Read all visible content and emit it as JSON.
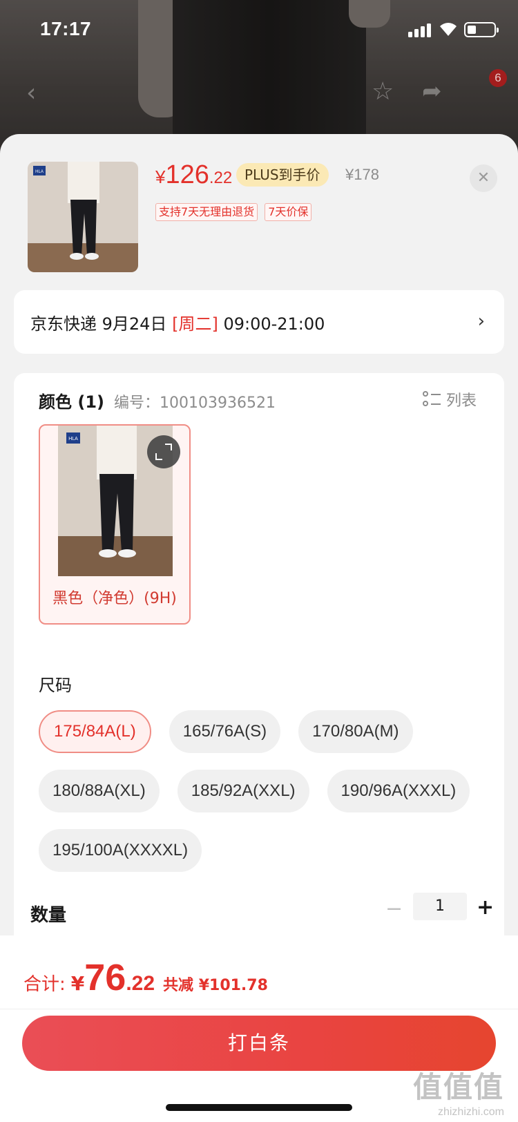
{
  "status_bar": {
    "time": "17:17"
  },
  "nav": {
    "cart_badge": "6"
  },
  "product": {
    "price_symbol": "¥",
    "price_int": "126",
    "price_dec": ".22",
    "plus_tag": "PLUS到手价",
    "original_price": "¥178",
    "tags": [
      "支持7天无理由退货",
      "7天价保"
    ]
  },
  "delivery": {
    "carrier": "京东快递 9月24日 ",
    "weekday": "[周二]",
    "window": " 09:00-21:00"
  },
  "spec": {
    "color_title": "颜色 (1)",
    "sku": "编号：100103936521",
    "list_label": "列表",
    "color_option": "黑色（净色）(9H)",
    "size_title": "尺码",
    "sizes": [
      "175/84A(L)",
      "165/76A(S)",
      "170/80A(M)",
      "180/88A(XL)",
      "185/92A(XXL)",
      "190/96A(XXXL)",
      "195/100A(XXXXL)"
    ],
    "selected_size": "175/84A(L)",
    "quantity_label": "数量",
    "quantity": "1"
  },
  "footer": {
    "total_label": "合计:",
    "total_symbol": "¥",
    "total_int": "76",
    "total_dec": ".22",
    "saving": "共减 ¥101.78",
    "button_label": "打白条"
  },
  "watermark": {
    "glyphs": "值值值",
    "url": "zhizhizhi.com"
  },
  "colors": {
    "accent": "#e3312b",
    "plus_bg": "#fbe9b5",
    "button": "#e94441"
  }
}
